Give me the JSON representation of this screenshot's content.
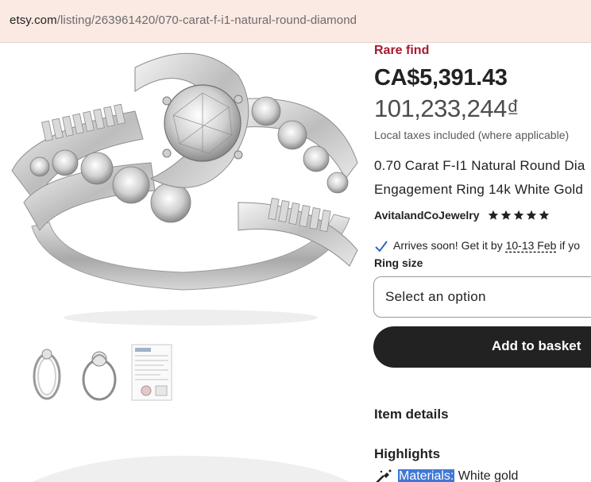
{
  "browser": {
    "url_host": "etsy.com",
    "url_path": "/listing/263961420/070-carat-f-i1-natural-round-diamond"
  },
  "product": {
    "badge": "Rare find",
    "price": "CA$5,391.43",
    "price_converted": "101,233,244₫",
    "taxes_note": "Local taxes included (where applicable)",
    "title_line1": "0.70 Carat F-I1 Natural Round Dia",
    "title_line2": "Engagement Ring 14k White Gold",
    "shop_name": "AvitalandCoJewelry",
    "rating_stars": 5,
    "arrival_prefix": "Arrives soon! Get it by ",
    "arrival_date": "10-13 Feb",
    "arrival_suffix": " if yo",
    "ring_size_label": "Ring size",
    "select_placeholder": "Select an option",
    "add_to_basket": "Add to basket",
    "item_details_heading": "Item details",
    "highlights_heading": "Highlights",
    "materials_label": "Materials:",
    "materials_value": " White gold"
  },
  "colors": {
    "badge": "#a61a2e",
    "button_bg": "#222222",
    "check": "#2f66c8",
    "selection_highlight": "#3f78d6",
    "urlbar_bg": "#fbe9e3"
  },
  "icons": {
    "check": "check-icon",
    "star": "star-icon",
    "materials": "materials-icon"
  },
  "thumbnails": [
    "ring-side-view",
    "ring-front-view",
    "certificate-document"
  ]
}
